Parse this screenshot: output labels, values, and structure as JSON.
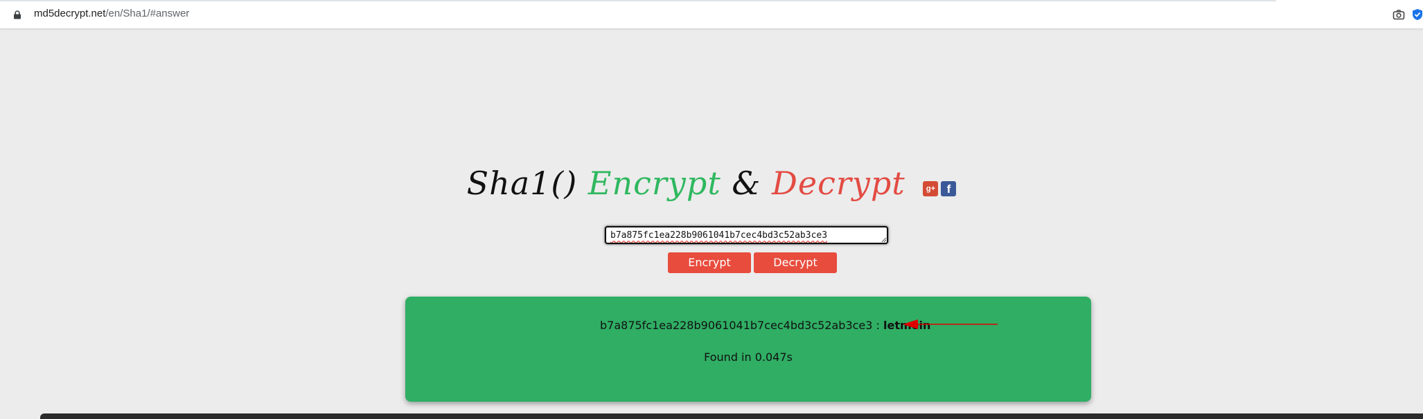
{
  "browser": {
    "url_host": "md5decrypt.net",
    "url_path": "/en/Sha1/#answer"
  },
  "heading": {
    "part1": "Sha1() ",
    "part2": "Encrypt",
    "part3": " & ",
    "part4": "Decrypt",
    "gplus_label": "g+",
    "fb_label": "f"
  },
  "form": {
    "input_value": "b7a875fc1ea228b9061041b7cec4bd3c52ab3ce3",
    "encrypt_label": "Encrypt",
    "decrypt_label": "Decrypt"
  },
  "result": {
    "hash": "b7a875fc1ea228b9061041b7cec4bd3c52ab3ce3",
    "separator": " : ",
    "answer": "letmein",
    "found_text": "Found in 0.047s"
  },
  "colors": {
    "encrypt_green": "#2fb85f",
    "decrypt_red": "#e34b43",
    "result_bg": "#2fae64",
    "button_bg": "#e84c3d",
    "arrow_red": "#e00000"
  }
}
